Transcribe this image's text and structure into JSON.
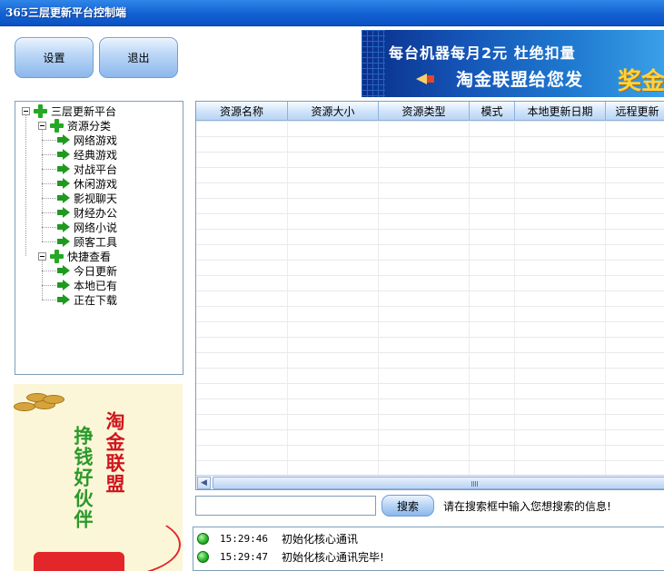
{
  "window": {
    "title": "365三层更新平台控制端"
  },
  "toolbar": {
    "settings_label": "设置",
    "exit_label": "退出"
  },
  "banner": {
    "line1": "每台机器每月2元  杜绝扣量",
    "line2": "淘金联盟给您发",
    "gold_text": "奖金",
    "bg_color": "#1556b8"
  },
  "tree": {
    "root": "三层更新平台",
    "group1": {
      "label": "资源分类",
      "items": [
        "网络游戏",
        "经典游戏",
        "对战平台",
        "休闲游戏",
        "影视聊天",
        "财经办公",
        "网络小说",
        "顾客工具"
      ]
    },
    "group2": {
      "label": "快捷查看",
      "items": [
        "今日更新",
        "本地已有",
        "正在下载"
      ]
    }
  },
  "side_ad": {
    "red_text": "淘金联盟",
    "green_text": "挣钱好伙伴"
  },
  "grid": {
    "columns": [
      "资源名称",
      "资源大小",
      "资源类型",
      "模式",
      "本地更新日期",
      "远程更新"
    ]
  },
  "search": {
    "value": "",
    "placeholder": "",
    "button_label": "搜索",
    "hint": "请在搜索框中输入您想搜索的信息!"
  },
  "log": [
    {
      "time": "15:29:46",
      "message": "初始化核心通讯",
      "status_color": "#28b82a"
    },
    {
      "time": "15:29:47",
      "message": "初始化核心通讯完毕!",
      "status_color": "#28b82a"
    }
  ]
}
